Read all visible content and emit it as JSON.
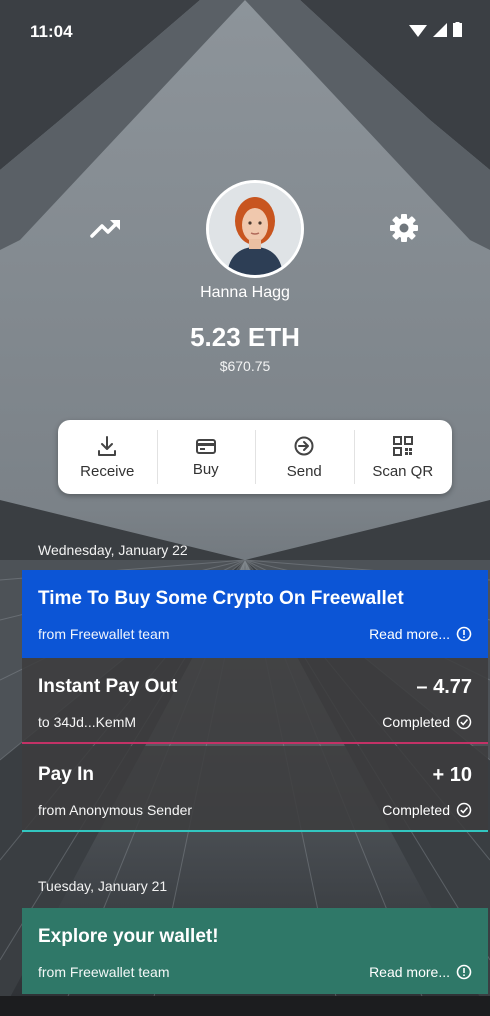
{
  "status_bar": {
    "time": "11:04"
  },
  "profile": {
    "name": "Hanna Hagg",
    "balance": "5.23 ETH",
    "fiat": "$670.75"
  },
  "actions": [
    {
      "label": "Receive",
      "icon": "download-icon"
    },
    {
      "label": "Buy",
      "icon": "card-icon"
    },
    {
      "label": "Send",
      "icon": "send-icon"
    },
    {
      "label": "Scan QR",
      "icon": "qr-icon"
    }
  ],
  "feed": {
    "date1": "Wednesday, January 22",
    "date2": "Tuesday, January 21",
    "promo1": {
      "title": "Time To Buy Some Crypto On Freewallet",
      "from": "from Freewallet team",
      "link": "Read more..."
    },
    "tx1": {
      "title": "Instant Pay Out",
      "to": "to 34Jd...KemM",
      "amount": "– 4.77",
      "status": "Completed"
    },
    "tx2": {
      "title": "Pay In",
      "from": "from Anonymous Sender",
      "amount": "+ 10",
      "status": "Completed"
    },
    "promo2": {
      "title": "Explore your wallet!",
      "from": "from Freewallet team",
      "link": "Read more..."
    }
  },
  "colors": {
    "promo_blue": "#0c55d6",
    "promo_green": "#2f7868",
    "payout_accent": "#c33266",
    "payin_accent": "#32c6c0"
  }
}
